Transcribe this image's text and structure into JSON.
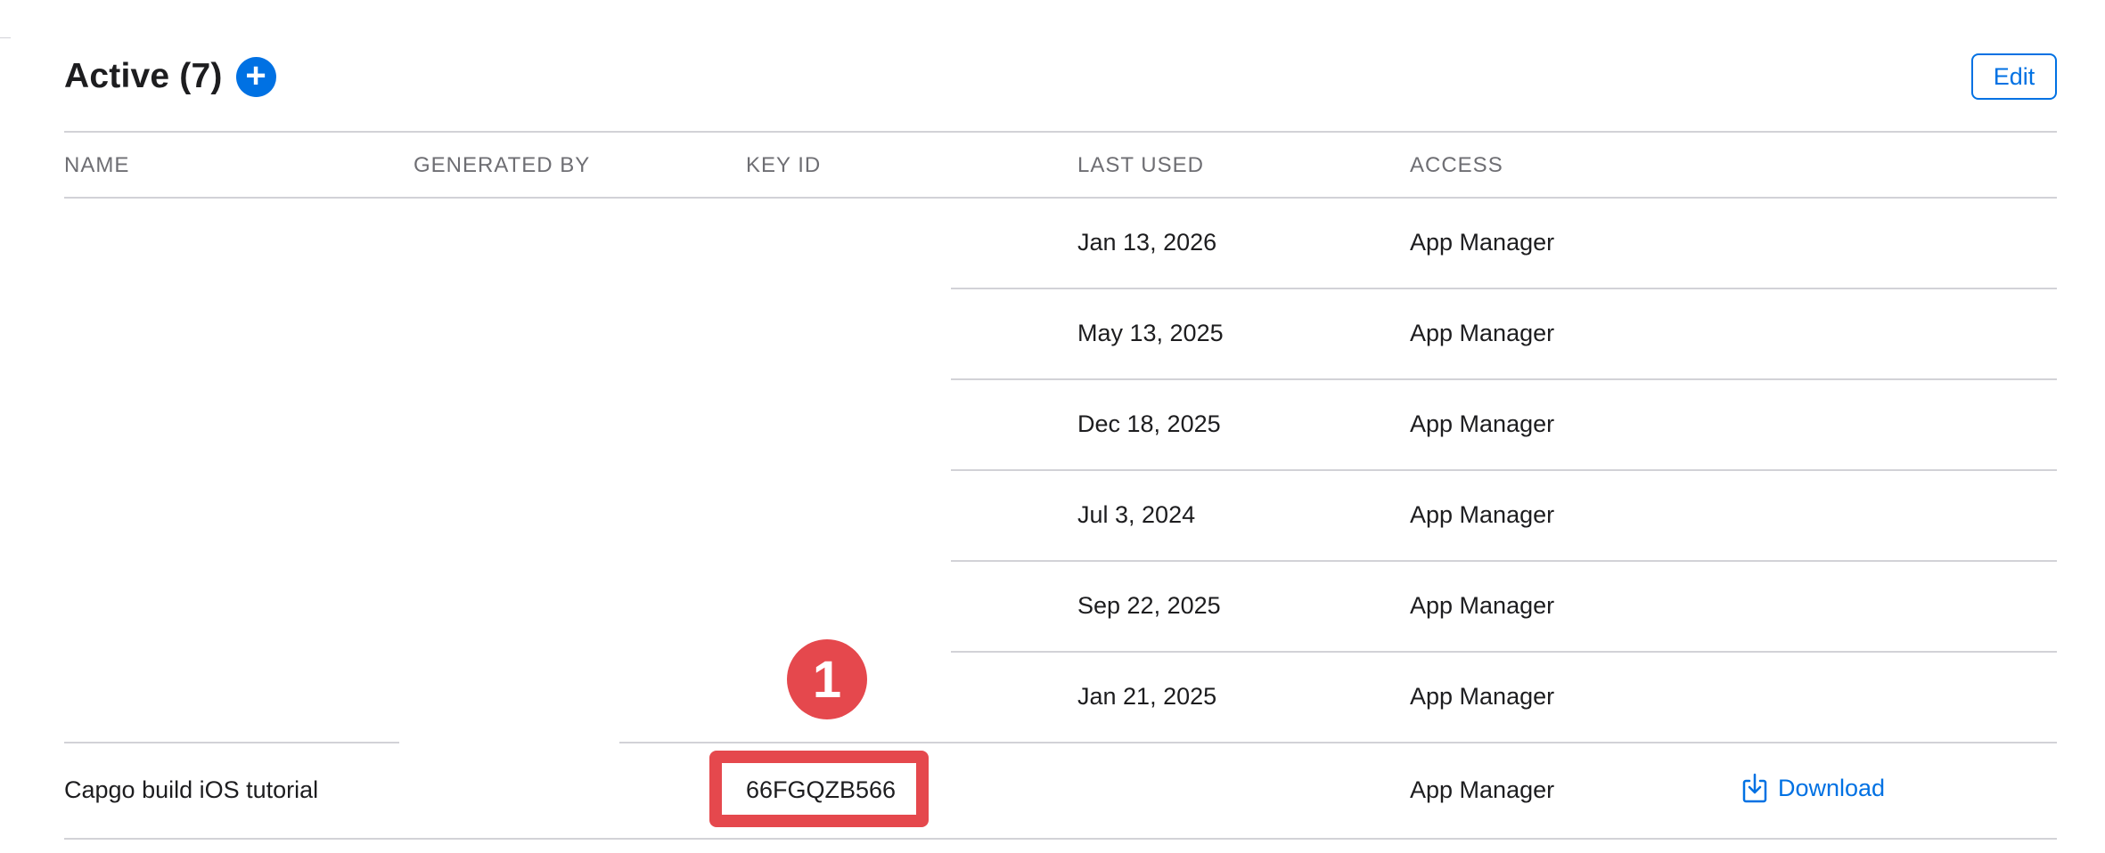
{
  "section": {
    "title": "Active (7)",
    "add_icon": "plus-circle-icon",
    "edit_label": "Edit"
  },
  "columns": [
    "NAME",
    "GENERATED BY",
    "KEY ID",
    "LAST USED",
    "ACCESS"
  ],
  "rows": [
    {
      "name": "",
      "generated_by": "",
      "key_id": "",
      "last_used": "Jan 13, 2026",
      "access": "App Manager"
    },
    {
      "name": "",
      "generated_by": "",
      "key_id": "",
      "last_used": "May 13, 2025",
      "access": "App Manager"
    },
    {
      "name": "",
      "generated_by": "",
      "key_id": "",
      "last_used": "Dec 18, 2025",
      "access": "App Manager"
    },
    {
      "name": "",
      "generated_by": "",
      "key_id": "",
      "last_used": "Jul 3, 2024",
      "access": "App Manager"
    },
    {
      "name": "",
      "generated_by": "",
      "key_id": "",
      "last_used": "Sep 22, 2025",
      "access": "App Manager"
    },
    {
      "name": "",
      "generated_by": "",
      "key_id": "",
      "last_used": "Jan 21, 2025",
      "access": "App Manager"
    },
    {
      "name": "Capgo build iOS tutorial",
      "generated_by": "",
      "key_id": "66FGQZB566",
      "last_used": "",
      "access": "App Manager",
      "action": "Download"
    }
  ],
  "annotation": {
    "badge": "1",
    "color": "#e5484d"
  },
  "colors": {
    "accent": "#0071e3",
    "divider": "#d2d2d7"
  }
}
